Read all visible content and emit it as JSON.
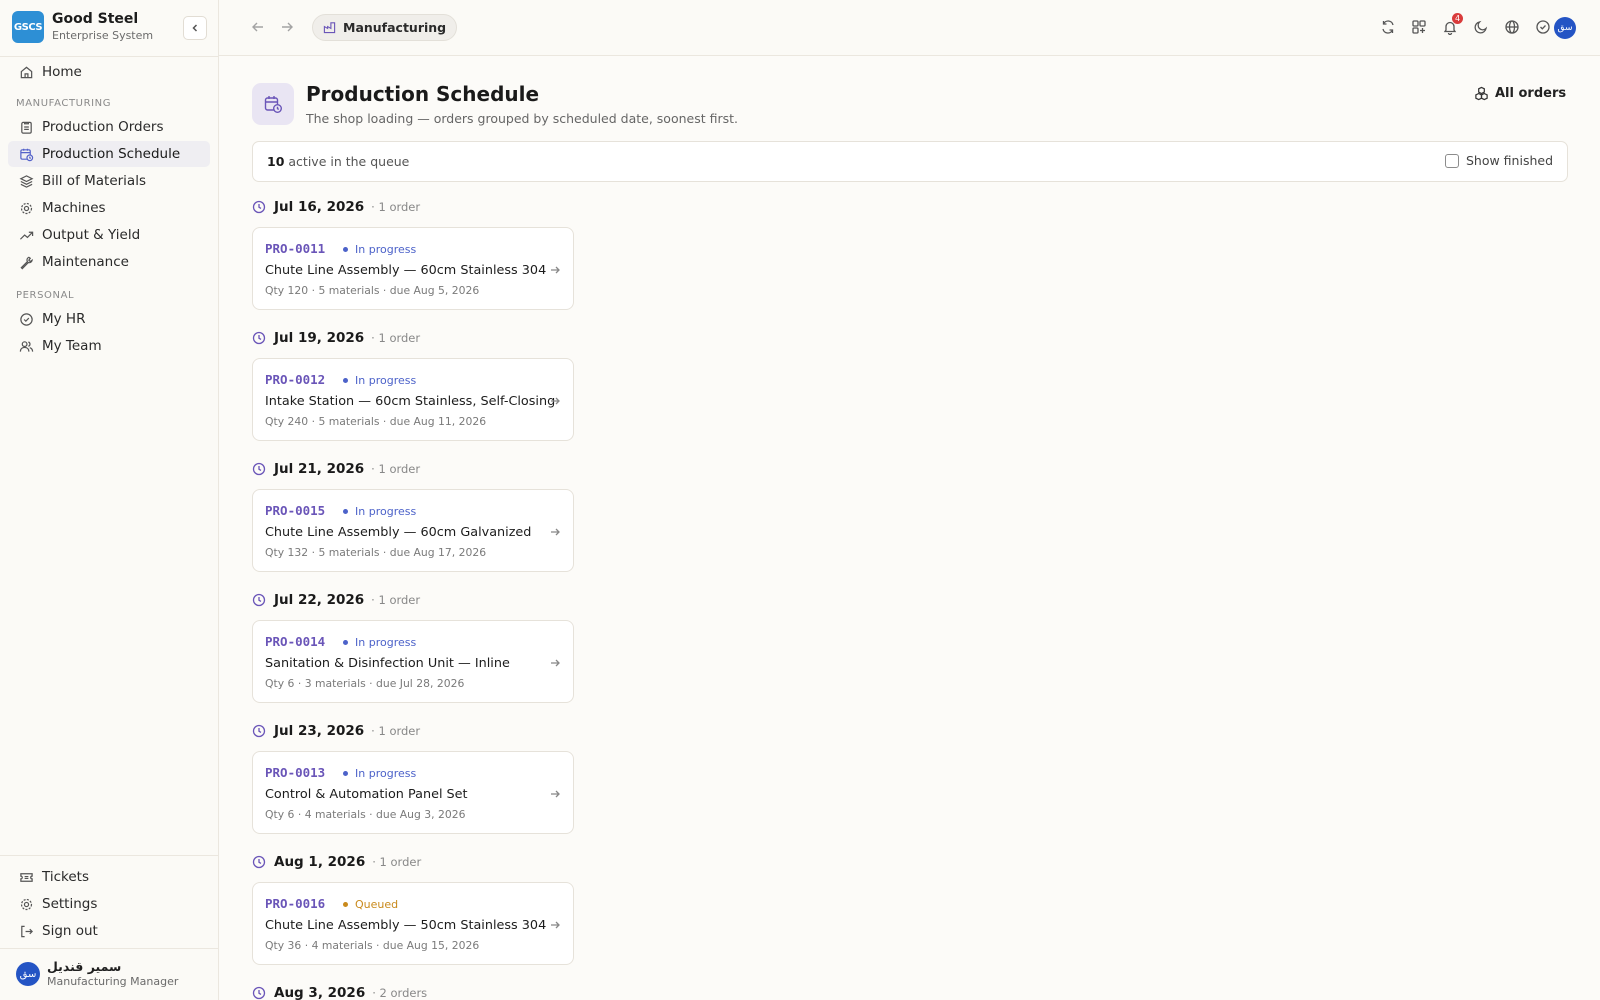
{
  "brand": {
    "logo": "GSCS",
    "name": "Good Steel",
    "subtitle": "Enterprise System"
  },
  "sidebar": {
    "home": "Home",
    "section_manufacturing": "MANUFACTURING",
    "manufacturing_items": [
      {
        "label": "Production Orders",
        "icon": "clipboard-icon"
      },
      {
        "label": "Production Schedule",
        "icon": "calendar-clock-icon",
        "active": true
      },
      {
        "label": "Bill of Materials",
        "icon": "layers-icon"
      },
      {
        "label": "Machines",
        "icon": "gear-icon"
      },
      {
        "label": "Output & Yield",
        "icon": "trend-up-icon"
      },
      {
        "label": "Maintenance",
        "icon": "wrench-icon"
      }
    ],
    "section_personal": "PERSONAL",
    "personal_items": [
      {
        "label": "My HR",
        "icon": "check-circle-icon"
      },
      {
        "label": "My Team",
        "icon": "users-icon"
      }
    ],
    "footer_items": [
      {
        "label": "Tickets",
        "icon": "ticket-icon"
      },
      {
        "label": "Settings",
        "icon": "gear-icon"
      },
      {
        "label": "Sign out",
        "icon": "sign-out-icon"
      }
    ],
    "user": {
      "initials": "سق",
      "name": "سمير قنديل",
      "role": "Manufacturing Manager"
    }
  },
  "topbar": {
    "breadcrumb": "Manufacturing",
    "notification_count": "4",
    "avatar_initials": "سق"
  },
  "page": {
    "title": "Production Schedule",
    "subtitle": "The shop loading — orders grouped by scheduled date, soonest first.",
    "all_orders_label": "All orders"
  },
  "queue": {
    "count": "10",
    "text": "active in the queue",
    "show_finished_label": "Show finished",
    "show_finished_checked": false
  },
  "groups": [
    {
      "date": "Jul 16, 2026",
      "count": "· 1 order",
      "order": {
        "code": "PRO-0011",
        "status": "In progress",
        "title": "Chute Line Assembly — 60cm Stainless 304",
        "meta": "Qty 120 · 5 materials · due Aug 5, 2026"
      }
    },
    {
      "date": "Jul 19, 2026",
      "count": "· 1 order",
      "order": {
        "code": "PRO-0012",
        "status": "In progress",
        "title": "Intake Station — 60cm Stainless, Self-Closing",
        "meta": "Qty 240 · 5 materials · due Aug 11, 2026"
      }
    },
    {
      "date": "Jul 21, 2026",
      "count": "· 1 order",
      "order": {
        "code": "PRO-0015",
        "status": "In progress",
        "title": "Chute Line Assembly — 60cm Galvanized",
        "meta": "Qty 132 · 5 materials · due Aug 17, 2026"
      }
    },
    {
      "date": "Jul 22, 2026",
      "count": "· 1 order",
      "order": {
        "code": "PRO-0014",
        "status": "In progress",
        "title": "Sanitation & Disinfection Unit — Inline",
        "meta": "Qty 6 · 3 materials · due Jul 28, 2026"
      }
    },
    {
      "date": "Jul 23, 2026",
      "count": "· 1 order",
      "order": {
        "code": "PRO-0013",
        "status": "In progress",
        "title": "Control & Automation Panel Set",
        "meta": "Qty 6 · 4 materials · due Aug 3, 2026"
      }
    },
    {
      "date": "Aug 1, 2026",
      "count": "· 1 order",
      "order": {
        "code": "PRO-0016",
        "status": "Queued",
        "title": "Chute Line Assembly — 50cm Stainless 304",
        "meta": "Qty 36 · 4 materials · due Aug 15, 2026"
      }
    },
    {
      "date": "Aug 3, 2026",
      "count": "· 2 orders"
    }
  ],
  "colors": {
    "in_progress": "#4c62c9",
    "queued": "#c98a1c",
    "accent": "#5462c9",
    "code": "#6a55b8"
  }
}
